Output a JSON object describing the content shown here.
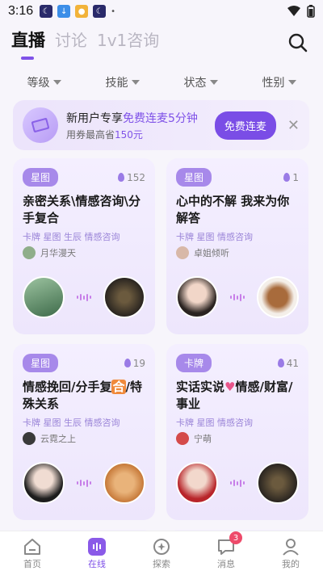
{
  "status_bar": {
    "time": "3:16"
  },
  "top_tabs": [
    {
      "label": "直播",
      "active": true
    },
    {
      "label": "讨论",
      "active": false
    },
    {
      "label": "1v1咨询",
      "active": false
    }
  ],
  "filters": [
    "等级",
    "技能",
    "状态",
    "性别"
  ],
  "promo": {
    "line1_prefix": "新用户专享",
    "line1_highlight": "免费连麦5分钟",
    "line2_prefix": "用券最高省",
    "line2_amount": "150元",
    "button": "免费连麦"
  },
  "cards": [
    {
      "tag": "星图",
      "count": "152",
      "title": "亲密关系\\情感咨询\\分手复合",
      "tags": "卡牌  星图  生辰  情感咨询",
      "user": "月华漫天"
    },
    {
      "tag": "星图",
      "count": "1",
      "title": "心中的不解  我来为你解答",
      "tags": "卡牌  星图  情感咨询",
      "user": "卓姐倾听"
    },
    {
      "tag": "星图",
      "count": "19",
      "title_a": "情感挽回/分手复",
      "title_badge": "合",
      "title_b": "/特殊关系",
      "tags": "卡牌  星图  生辰  情感咨询",
      "user": "云霓之上"
    },
    {
      "tag": "卡牌",
      "count": "41",
      "title_a": "实话实说",
      "title_b": "情感/财富/事业",
      "tags": "卡牌  星图  情感咨询",
      "user": "宁萌"
    }
  ],
  "nav": [
    {
      "label": "首页",
      "icon": "home-icon"
    },
    {
      "label": "在线",
      "icon": "live-icon",
      "active": true
    },
    {
      "label": "探索",
      "icon": "explore-icon"
    },
    {
      "label": "消息",
      "icon": "message-icon",
      "badge": "3"
    },
    {
      "label": "我的",
      "icon": "profile-icon"
    }
  ],
  "colors": {
    "accent": "#7f52e8",
    "tag_bg": "#a789ea",
    "badge": "#ee4a6a"
  }
}
